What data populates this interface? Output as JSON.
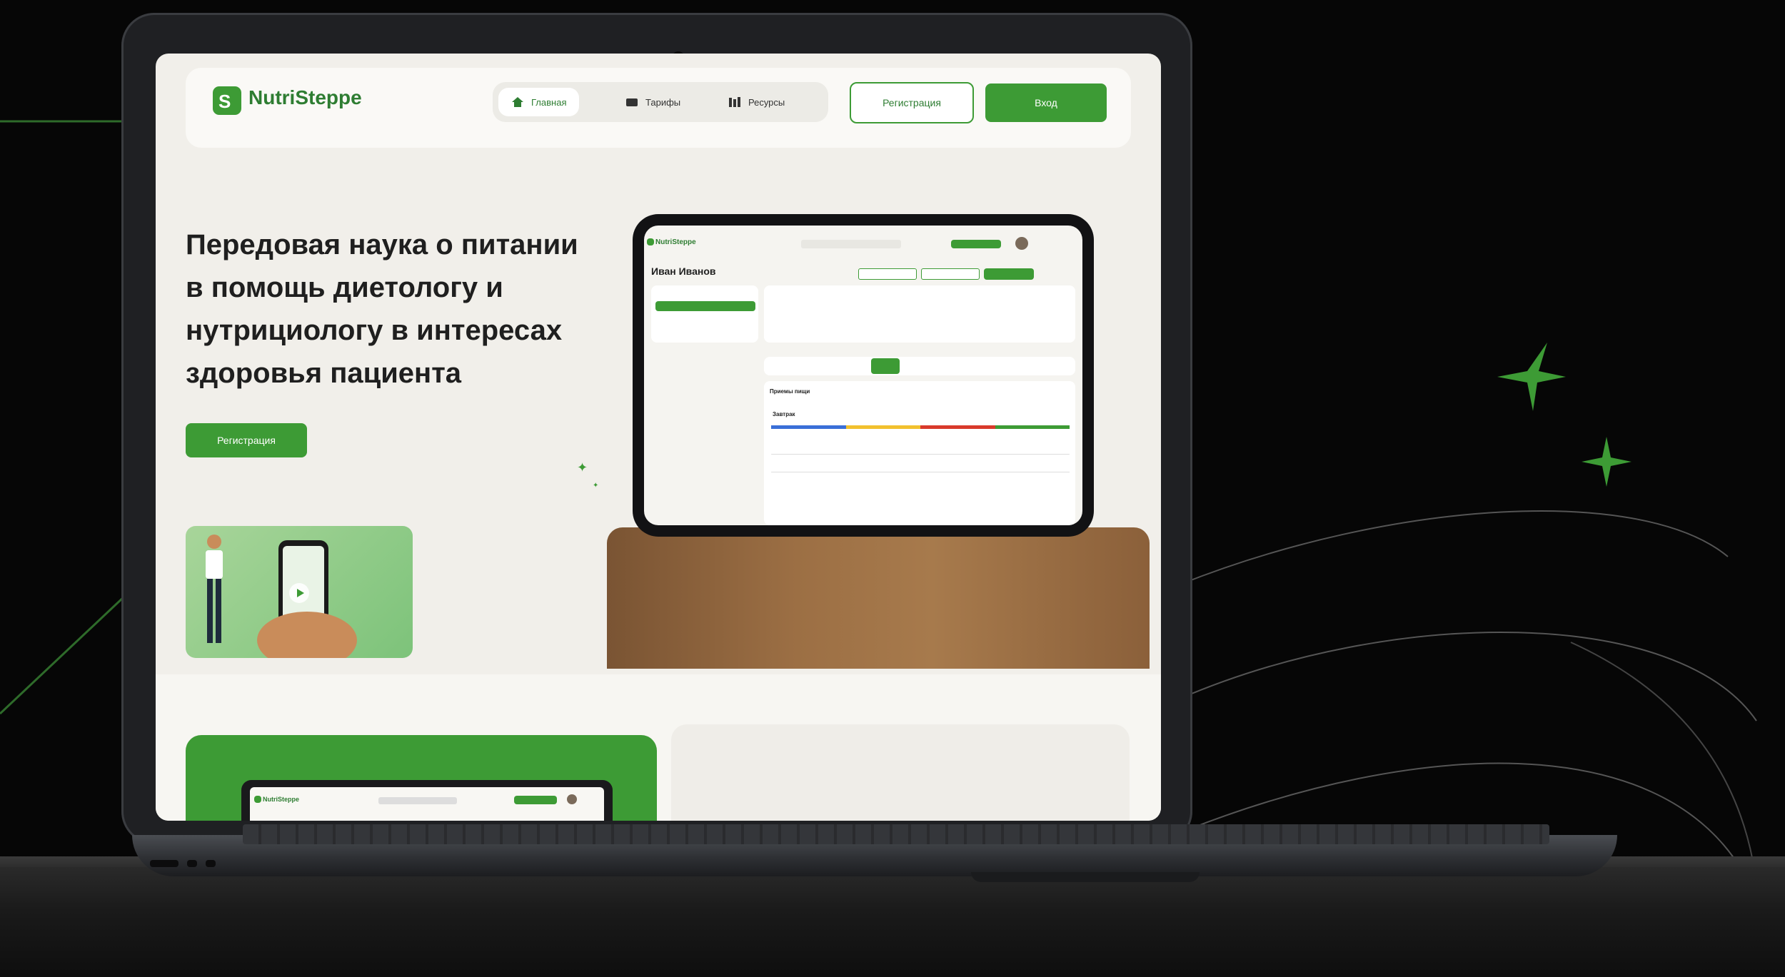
{
  "nav": {
    "brand": "NutriSteppe",
    "items": [
      {
        "label": "Главная",
        "active": true
      },
      {
        "label": "Тарифы",
        "active": false
      },
      {
        "label": "Ресурсы",
        "active": false
      }
    ],
    "register": "Регистрация",
    "login": "Вход"
  },
  "hero": {
    "title_lines": [
      "Передовая наука о питании",
      "в помощь диетологу и",
      "нутрициологу в интересах",
      "здоровья пациента"
    ],
    "cta": "Регистрация"
  },
  "tablet": {
    "brand": "NutriSteppe",
    "patient": "Иван Иванов",
    "meals_heading": "Приемы пищи",
    "breakfast": "Завтрак"
  },
  "mini_laptop": {
    "brand": "NutriSteppe"
  },
  "colors": {
    "accent": "#3d9b35",
    "background": "#060606",
    "screen_bg": "#f1efea"
  },
  "icons": [
    "home-icon",
    "tariffs-icon",
    "resources-icon",
    "logo-icon",
    "play-icon",
    "sparkle-icon"
  ]
}
